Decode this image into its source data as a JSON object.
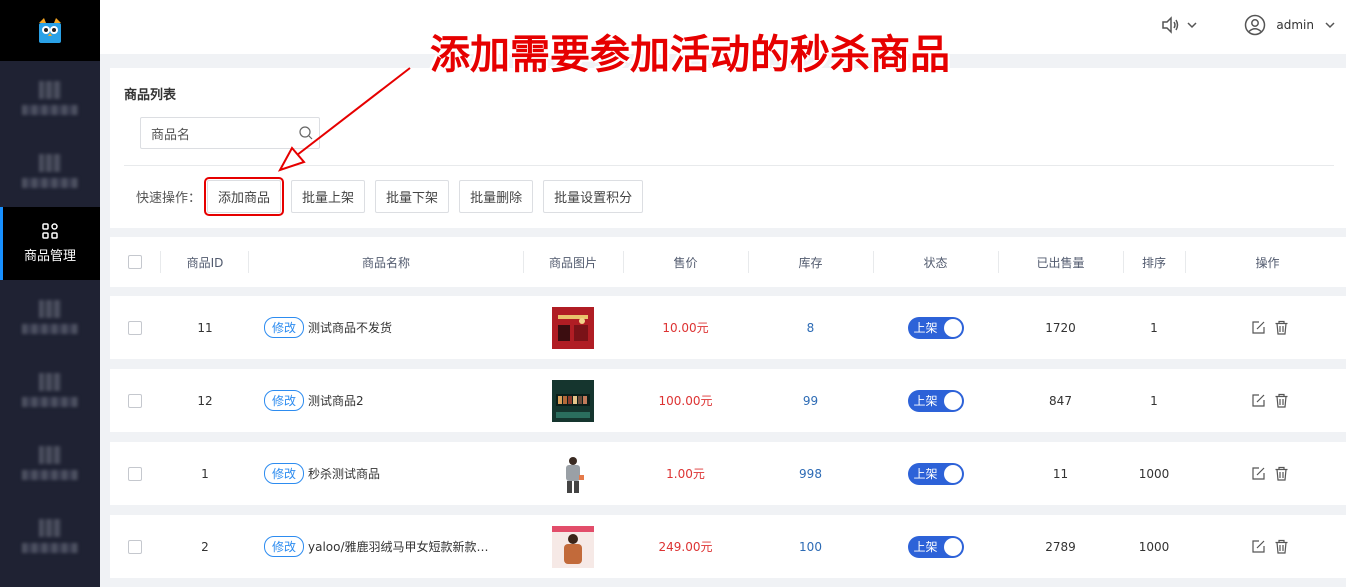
{
  "sidebar": {
    "active_label": "商品管理"
  },
  "header": {
    "user": "admin"
  },
  "annotation": {
    "title": "添加需要参加活动的秒杀商品"
  },
  "panel": {
    "title": "商品列表",
    "search_placeholder": "商品名",
    "quick_label": "快速操作：",
    "buttons": [
      "添加商品",
      "批量上架",
      "批量下架",
      "批量删除",
      "批量设置积分"
    ]
  },
  "table": {
    "headers": [
      "商品ID",
      "商品名称",
      "商品图片",
      "售价",
      "库存",
      "状态",
      "已出售量",
      "排序",
      "操作"
    ],
    "edit_tag": "修改",
    "rows": [
      {
        "id": "11",
        "name": "测试商品不发货",
        "price": "10.00元",
        "stock": "8",
        "status": "上架",
        "sold": "1720",
        "sort": "1"
      },
      {
        "id": "12",
        "name": "测试商品2",
        "price": "100.00元",
        "stock": "99",
        "status": "上架",
        "sold": "847",
        "sort": "1"
      },
      {
        "id": "1",
        "name": "秒杀测试商品",
        "price": "1.00元",
        "stock": "998",
        "status": "上架",
        "sold": "11",
        "sort": "1000"
      },
      {
        "id": "2",
        "name": "yaloo/雅鹿羽绒马甲女短款新款韩...",
        "price": "249.00元",
        "stock": "100",
        "status": "上架",
        "sold": "2789",
        "sort": "1000"
      }
    ]
  },
  "colors": {
    "sidebar_bg": "#1f2233",
    "accent": "#2d62d8",
    "price": "#dd3333",
    "annotation": "#e60000"
  }
}
